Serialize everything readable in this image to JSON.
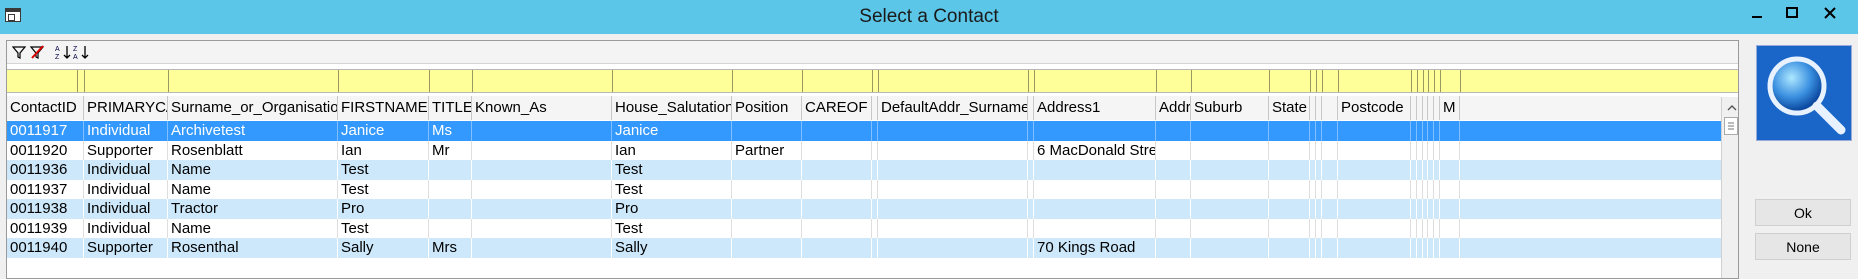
{
  "window": {
    "title": "Select a Contact"
  },
  "columns": [
    "ContactID",
    "PRIMARYCA",
    "Surname_or_Organisation",
    "FIRSTNAME",
    "TITLE",
    "Known_As",
    "House_Salutation",
    "Position",
    "CAREOF",
    "",
    "DefaultAddr_Surname",
    "",
    "Address1",
    "Addr",
    "Suburb",
    "State",
    "",
    "",
    "",
    "Postcode",
    "",
    "",
    "",
    "",
    "",
    "M"
  ],
  "rows": [
    [
      "0011917",
      "Individual",
      "Archivetest",
      "Janice",
      "Ms",
      "",
      "Janice",
      "",
      "",
      "",
      "",
      "",
      "",
      "",
      "",
      "",
      "",
      "",
      "",
      "",
      "",
      "",
      "",
      "",
      "",
      ""
    ],
    [
      "0011920",
      "Supporter",
      "Rosenblatt",
      "Ian",
      "Mr",
      "",
      "Ian",
      "Partner",
      "",
      "",
      "",
      "",
      "6 MacDonald Stree",
      "",
      "",
      "",
      "",
      "",
      "",
      "",
      "",
      "",
      "",
      "",
      "",
      ""
    ],
    [
      "0011936",
      "Individual",
      "Name",
      "Test",
      "",
      "",
      "Test",
      "",
      "",
      "",
      "",
      "",
      "",
      "",
      "",
      "",
      "",
      "",
      "",
      "",
      "",
      "",
      "",
      "",
      "",
      ""
    ],
    [
      "0011937",
      "Individual",
      "Name",
      "Test",
      "",
      "",
      "Test",
      "",
      "",
      "",
      "",
      "",
      "",
      "",
      "",
      "",
      "",
      "",
      "",
      "",
      "",
      "",
      "",
      "",
      "",
      ""
    ],
    [
      "0011938",
      "Individual",
      "Tractor",
      "Pro",
      "",
      "",
      "Pro",
      "",
      "",
      "",
      "",
      "",
      "",
      "",
      "",
      "",
      "",
      "",
      "",
      "",
      "",
      "",
      "",
      "",
      "",
      ""
    ],
    [
      "0011939",
      "Individual",
      "Name",
      "Test",
      "",
      "",
      "Test",
      "",
      "",
      "",
      "",
      "",
      "",
      "",
      "",
      "",
      "",
      "",
      "",
      "",
      "",
      "",
      "",
      "",
      "",
      ""
    ],
    [
      "0011940",
      "Supporter",
      "Rosenthal",
      "Sally",
      "Mrs",
      "",
      "Sally",
      "",
      "",
      "",
      "",
      "",
      "70 Kings Road",
      "",
      "",
      "",
      "",
      "",
      "",
      "",
      "",
      "",
      "",
      "",
      "",
      ""
    ]
  ],
  "buttons": {
    "ok": "Ok",
    "none": "None"
  }
}
